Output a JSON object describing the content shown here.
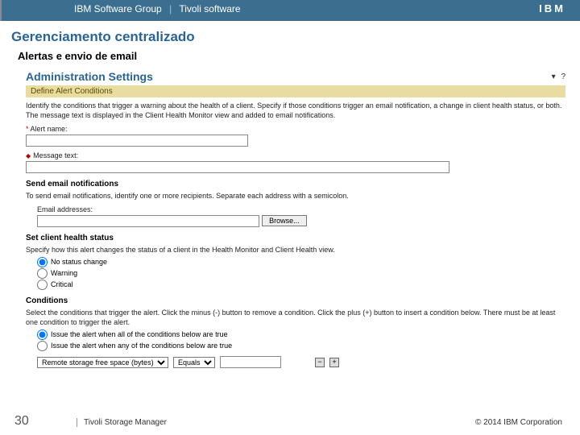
{
  "topbar": {
    "left1": "IBM Software Group",
    "left2": "Tivoli software",
    "logo_alt": "IBM"
  },
  "slide": {
    "title": "Gerenciamento centralizado",
    "subtitle": "Alertas e envio de email"
  },
  "admin": {
    "header": "Administration Settings",
    "header_icons": {
      "collapse": "▾",
      "help": "?"
    },
    "yellowbar": "Define Alert Conditions",
    "intro": "Identify the conditions that trigger a warning about the health of a client. Specify if those conditions trigger an email notification, a change in client health status, or both. The message text is displayed in the Client Health Monitor view and added to email notifications.",
    "alert_name": {
      "label": "Alert name:",
      "value": ""
    },
    "message": {
      "label": "Message text:",
      "value": ""
    },
    "send_section": "Send email notifications",
    "send_desc": "To send email notifications, identify one or more recipients. Separate each address with a semicolon.",
    "email": {
      "label": "Email addresses:",
      "value": "",
      "browse": "Browse..."
    },
    "health_section": "Set client health status",
    "health_desc": "Specify how this alert changes the status of a client in the Health Monitor and Client Health view.",
    "health_options": [
      {
        "label": "No status change",
        "checked": true
      },
      {
        "label": "Warning",
        "checked": false
      },
      {
        "label": "Critical",
        "checked": false
      }
    ],
    "cond_section": "Conditions",
    "cond_desc": "Select the conditions that trigger the alert. Click the minus (-) button to remove a condition. Click the plus (+) button to insert a condition below. There must be at least one condition to trigger the alert.",
    "cond_rule_options": [
      {
        "label": "Issue the alert when all of the conditions below are true",
        "checked": true
      },
      {
        "label": "Issue the alert when any of the conditions below are true",
        "checked": false
      }
    ],
    "cond_row": {
      "field": "Remote storage free space (bytes)",
      "operator": "Equals",
      "value": "",
      "plus": "+",
      "minus": "−"
    }
  },
  "footer": {
    "page": "30",
    "product": "Tivoli Storage Manager",
    "copyright": "© 2014 IBM Corporation"
  }
}
